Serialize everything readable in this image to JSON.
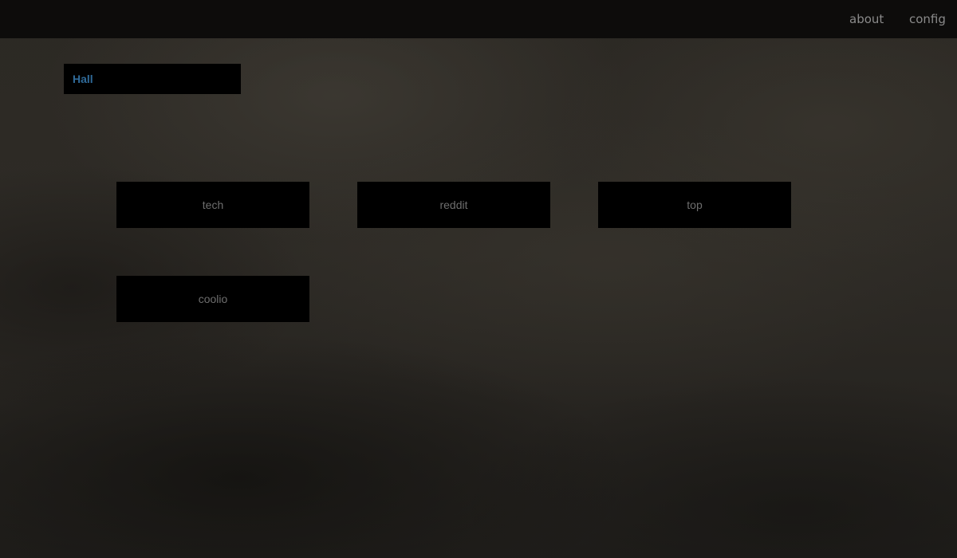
{
  "nav": {
    "about_label": "about",
    "config_label": "config"
  },
  "board": {
    "title": "Hall",
    "title_color": "#2f6a99"
  },
  "tiles": [
    {
      "label": "tech"
    },
    {
      "label": "reddit"
    },
    {
      "label": "top"
    },
    {
      "label": "coolio"
    }
  ]
}
